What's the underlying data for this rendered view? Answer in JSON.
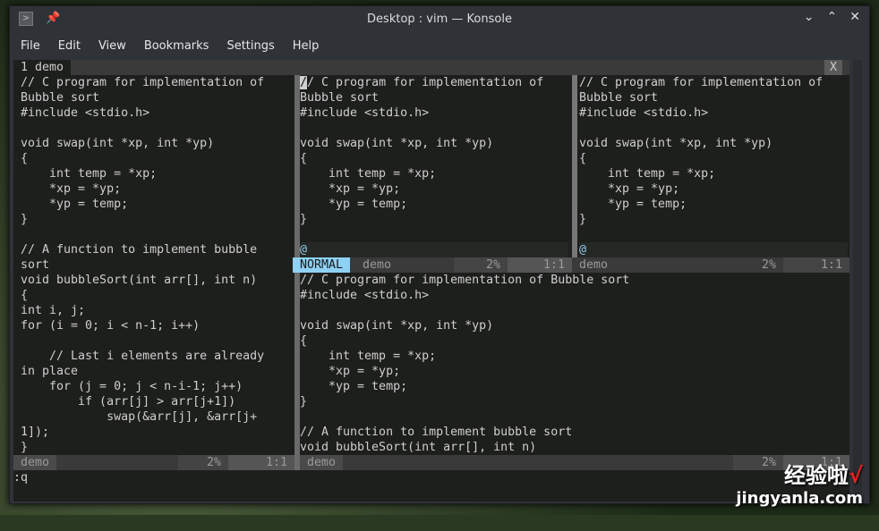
{
  "window": {
    "title": "Desktop : vim — Konsole"
  },
  "menu": [
    "File",
    "Edit",
    "View",
    "Bookmarks",
    "Settings",
    "Help"
  ],
  "tabline": {
    "tab": "1 demo",
    "close": "X"
  },
  "left_pane": [
    "// C program for implementation of",
    "Bubble sort",
    "#include <stdio.h>",
    "",
    "void swap(int *xp, int *yp)",
    "{",
    "    int temp = *xp;",
    "    *xp = *yp;",
    "    *yp = temp;",
    "}",
    "",
    "// A function to implement bubble",
    "sort",
    "void bubbleSort(int arr[], int n)",
    "{",
    "int i, j;",
    "for (i = 0; i < n-1; i++)",
    "",
    "    // Last i elements are already",
    "in place",
    "    for (j = 0; j < n-i-1; j++)",
    "        if (arr[j] > arr[j+1])",
    "            swap(&arr[j], &arr[j+",
    "1]);",
    "}"
  ],
  "middle_pane": [
    "// C program for implementation of",
    "Bubble sort",
    "#include <stdio.h>",
    "",
    "void swap(int *xp, int *yp)",
    "{",
    "    int temp = *xp;",
    "    *xp = *yp;",
    "    *yp = temp;",
    "}",
    "",
    "@"
  ],
  "right_pane": [
    "// C program for implementation of",
    "Bubble sort",
    "#include <stdio.h>",
    "",
    "void swap(int *xp, int *yp)",
    "{",
    "    int temp = *xp;",
    "    *xp = *yp;",
    "    *yp = temp;",
    "}",
    "",
    "@"
  ],
  "bottom_pane": [
    "// C program for implementation of Bubble sort",
    "#include <stdio.h>",
    "",
    "void swap(int *xp, int *yp)",
    "{",
    "    int temp = *xp;",
    "    *xp = *yp;",
    "    *yp = temp;",
    "}",
    "",
    "// A function to implement bubble sort",
    "void bubbleSort(int arr[], int n)"
  ],
  "status": {
    "mode": "NORMAL",
    "file": "demo",
    "percent": "2%",
    "position": "1:1"
  },
  "cmdline": ":q",
  "watermark": {
    "line1": "经验啦",
    "check": "√",
    "line2": "jingyanla.com"
  }
}
